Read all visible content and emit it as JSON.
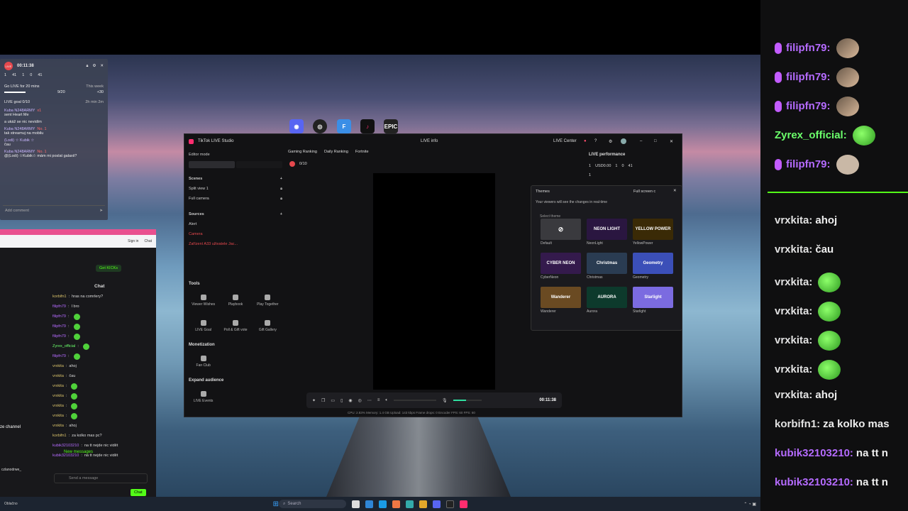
{
  "wallpaper": "sky-lake-pier",
  "taskbar": {
    "search_placeholder": "Search",
    "weather_label": "Oblačno"
  },
  "desktop_icons": [
    "discord-icon",
    "obs-icon",
    "finder-icon",
    "tiktok-icon",
    "epic-games-icon"
  ],
  "epic_label": "EPIC",
  "studio": {
    "title": "TikTok LIVE Studio",
    "live_info": "LIVE info",
    "live_center": "LIVE Center",
    "editor_mode": "Editor mode",
    "scenes_title": "Scenes",
    "scenes": [
      "Split view 1",
      "Full camera"
    ],
    "sources_title": "Sources",
    "sources": [
      "Alert",
      "Camera",
      "Zařízení A33 uživatele Jac..."
    ],
    "tools_title": "Tools",
    "tools": [
      "Viewer Wishes",
      "Playbook",
      "Play Together",
      "LIVE Goal",
      "Poll & Gift vote",
      "Gift Gallery"
    ],
    "monetization_title": "Monetization",
    "monetization": [
      "Fan Club"
    ],
    "expand_title": "Expand audience",
    "expand": [
      "LIVE Events"
    ],
    "rank_tabs": [
      "Gaming Ranking",
      "Daily Ranking",
      "Fortnite"
    ],
    "goal": "0/10",
    "timer": "00:11:38",
    "status_bar": "CPU: 2.83%    Memory: 1.4 GB    Upload: 143 kbps    Frame drops: 0    Encoder FPS: 60    FPS: 60",
    "performance_title": "LIVE performance",
    "performance": {
      "viewers": "1",
      "usd": "USD0.00",
      "users": "1",
      "follows": "0",
      "likes": "41",
      "gifts": "1"
    },
    "themes_panel": {
      "title": "Themes",
      "dropdown": "Full screen c",
      "notice": "Your viewers will see the changes in real-time",
      "select_label": "Select theme",
      "themes": [
        {
          "name": "Default",
          "art": "",
          "color": "#3a3a3e"
        },
        {
          "name": "NeonLight",
          "art": "NEON LIGHT",
          "color": "#2a1640"
        },
        {
          "name": "YellowPower",
          "art": "YELLOW POWER",
          "color": "#3a2a06"
        },
        {
          "name": "CyberNeon",
          "art": "CYBER NEON",
          "color": "#341a4c"
        },
        {
          "name": "Christmas",
          "art": "Christmas",
          "color": "#2a3c52"
        },
        {
          "name": "Geometry",
          "art": "Geometry",
          "color": "#3b4fb8"
        },
        {
          "name": "Wanderer",
          "art": "Wanderer",
          "color": "#6a4a22"
        },
        {
          "name": "Aurora",
          "art": "AURORA",
          "color": "#0d3a2c"
        },
        {
          "name": "Starlight",
          "art": "Starlight",
          "color": "#7b6be0"
        }
      ]
    }
  },
  "live_widget": {
    "badge": "LIVE",
    "timer": "00:11:38",
    "stats": [
      "1",
      "41",
      "1",
      "0",
      "41"
    ],
    "goal_title": "Go LIVE for 20 mins",
    "goal_period": "This week",
    "goal_progress": "9/20",
    "goal_reward": "+30",
    "live_goal": "LIVE goal 0/10",
    "live_goal_time": "2h min 2m",
    "messages": [
      {
        "user": "Kuba N248ARMY",
        "text": "sent Heart Me",
        "extra": "x1"
      },
      {
        "user": "",
        "text": "a ukáž se nic nevidím",
        "extra": ""
      },
      {
        "user": "Kuba N248ARMY",
        "text": "tak streamuj na mobilu",
        "extra": "No. 1"
      },
      {
        "user": "(Lodi) ☆ Kubik ☆",
        "text": "čau",
        "extra": ""
      },
      {
        "user": "Kuba N248ARMY",
        "text": "@(Lodi) ☆Kubik☆ mám mi poslat galaxii?",
        "extra": "No. 1"
      }
    ],
    "add_comment": "Add comment"
  },
  "browser": {
    "tab_title": "Watch Live on K",
    "signin": "Sign in",
    "chat_label": "Chat",
    "get_kicks": "Get KICKs",
    "chat_title": "Chat",
    "channel_label": "ze channel",
    "new_messages": "New messages",
    "send_placeholder": "Send a message",
    "send_button": "Chat",
    "username_partial": "czlanodrwe_",
    "lines": [
      {
        "user": "korbifn1",
        "text": "hras na comrlery?",
        "color": "#d9c26a"
      },
      {
        "user": "filipfn79",
        "text": "I bro",
        "color": "#b56bff"
      },
      {
        "user": "filipfn79",
        "text": "",
        "color": "#b56bff"
      },
      {
        "user": "filipfn79",
        "text": "",
        "color": "#b56bff"
      },
      {
        "user": "filipfn79",
        "text": "",
        "color": "#b56bff"
      },
      {
        "user": "Zyrex_official",
        "text": "",
        "color": "#6bff6b"
      },
      {
        "user": "filipfn79",
        "text": "",
        "color": "#b56bff"
      },
      {
        "user": "vrxkita",
        "text": "ahoj",
        "color": "#d9c26a"
      },
      {
        "user": "vrxkita",
        "text": "čau",
        "color": "#d9c26a"
      },
      {
        "user": "vrxkita",
        "text": "",
        "color": "#d9c26a"
      },
      {
        "user": "vrxkita",
        "text": "",
        "color": "#d9c26a"
      },
      {
        "user": "vrxkita",
        "text": "",
        "color": "#d9c26a"
      },
      {
        "user": "vrxkita",
        "text": "",
        "color": "#d9c26a"
      },
      {
        "user": "vrxkita",
        "text": "ahoj",
        "color": "#d9c26a"
      },
      {
        "user": "korbifn1",
        "text": "za kolko mas pc?",
        "color": "#d9c26a"
      },
      {
        "user": "kubik32103210",
        "text": "na tt nejde nic vidět",
        "color": "#b56bff"
      },
      {
        "user": "kubik32103210",
        "text": "na tt nejde nic vidět",
        "color": "#b56bff"
      }
    ]
  },
  "right_chat": [
    {
      "user": "filipfn79:",
      "text": "",
      "color": "#b56bff",
      "mic": true,
      "emote": "face"
    },
    {
      "user": "filipfn79:",
      "text": "",
      "color": "#b56bff",
      "mic": true,
      "emote": "face"
    },
    {
      "user": "filipfn79:",
      "text": "",
      "color": "#b56bff",
      "mic": true,
      "emote": "face"
    },
    {
      "user": "Zyrex_official:",
      "text": "",
      "color": "#6bff6b",
      "mic": false,
      "emote": "green"
    },
    {
      "user": "filipfn79:",
      "text": "",
      "color": "#b56bff",
      "mic": true,
      "emote": "cat"
    },
    {
      "user": "vrxkita:",
      "text": "ahoj",
      "color": "#e2e2e2",
      "mic": false,
      "emote": ""
    },
    {
      "user": "vrxkita:",
      "text": "čau",
      "color": "#e2e2e2",
      "mic": false,
      "emote": ""
    },
    {
      "user": "vrxkita:",
      "text": "",
      "color": "#e2e2e2",
      "mic": false,
      "emote": "green"
    },
    {
      "user": "vrxkita:",
      "text": "",
      "color": "#e2e2e2",
      "mic": false,
      "emote": "green"
    },
    {
      "user": "vrxkita:",
      "text": "",
      "color": "#e2e2e2",
      "mic": false,
      "emote": "green"
    },
    {
      "user": "vrxkita:",
      "text": "",
      "color": "#e2e2e2",
      "mic": false,
      "emote": "green"
    },
    {
      "user": "vrxkita:",
      "text": "ahoj",
      "color": "#e2e2e2",
      "mic": false,
      "emote": ""
    },
    {
      "user": "korbifn1:",
      "text": "za kolko mas",
      "color": "#e2e2e2",
      "mic": false,
      "emote": ""
    },
    {
      "user": "kubik32103210:",
      "text": "na tt n",
      "color": "#b56bff",
      "mic": false,
      "emote": ""
    },
    {
      "user": "kubik32103210:",
      "text": "na tt n",
      "color": "#b56bff",
      "mic": false,
      "emote": ""
    }
  ]
}
